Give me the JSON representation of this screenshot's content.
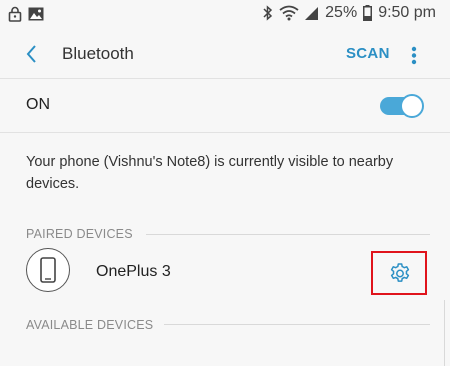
{
  "status_bar": {
    "battery_percent": "25%",
    "time": "9:50 pm",
    "icons": [
      "lock-icon",
      "image-icon",
      "bluetooth-icon",
      "wifi-icon",
      "signal-icon",
      "battery-icon"
    ]
  },
  "app_bar": {
    "title": "Bluetooth",
    "scan_label": "SCAN",
    "back_icon": "chevron-left-icon",
    "more_icon": "more-vert-icon"
  },
  "bluetooth_toggle": {
    "label": "ON",
    "enabled": true
  },
  "visibility_message": "Your phone (Vishnu's Note8) is currently visible to nearby devices.",
  "paired_section": {
    "header": "PAIRED DEVICES",
    "devices": [
      {
        "name": "OnePlus 3",
        "icon": "phone-icon",
        "settings_icon": "gear-icon"
      }
    ]
  },
  "available_section": {
    "header": "AVAILABLE DEVICES"
  },
  "colors": {
    "accent": "#2b8fc4",
    "switch": "#4aa8d8",
    "highlight": "#e0141c",
    "background": "#f7f7f7"
  }
}
